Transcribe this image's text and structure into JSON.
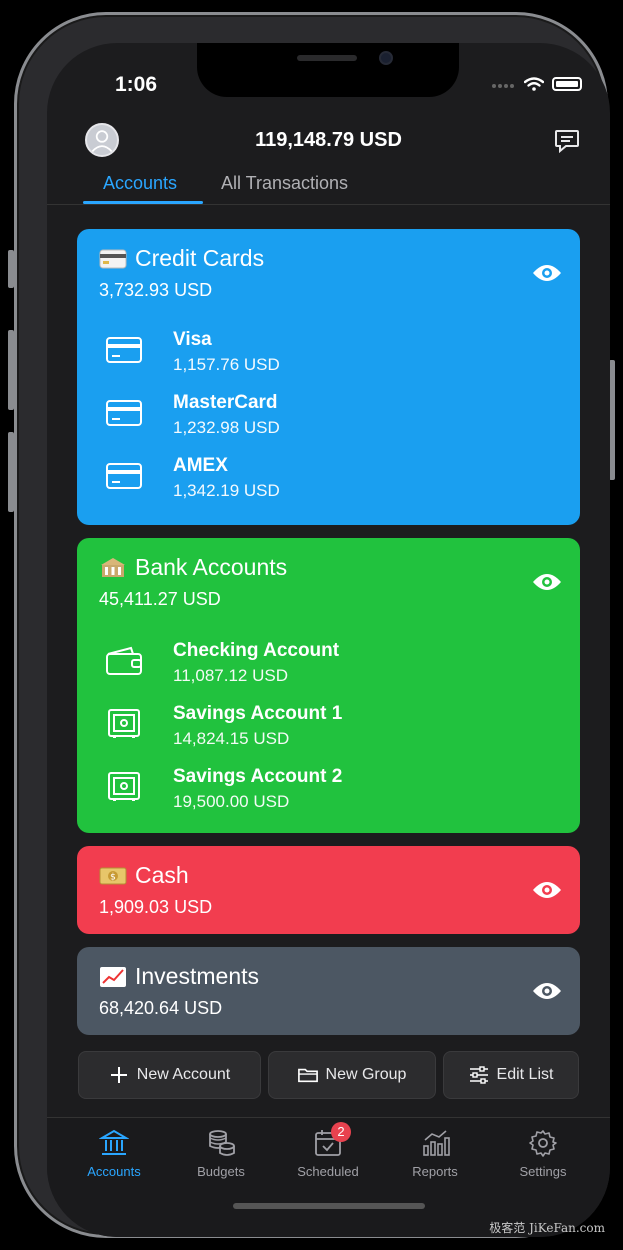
{
  "status": {
    "time": "1:06"
  },
  "header": {
    "total": "119,148.79 USD"
  },
  "tabs": [
    {
      "label": "Accounts",
      "active": true
    },
    {
      "label": "All Transactions",
      "active": false
    }
  ],
  "groups": {
    "credit": {
      "title": "Credit Cards",
      "emoji": "credit-card",
      "total": "3,732.93 USD",
      "color": "#1a9ff0",
      "accounts": [
        {
          "name": "Visa",
          "balance": "1,157.76 USD",
          "icon": "card-icon"
        },
        {
          "name": "MasterCard",
          "balance": "1,232.98 USD",
          "icon": "card-icon"
        },
        {
          "name": "AMEX",
          "balance": "1,342.19 USD",
          "icon": "card-icon"
        }
      ]
    },
    "bank": {
      "title": "Bank Accounts",
      "emoji": "bank",
      "total": "45,411.27 USD",
      "color": "#21c23e",
      "accounts": [
        {
          "name": "Checking Account",
          "balance": "11,087.12 USD",
          "icon": "wallet-icon"
        },
        {
          "name": "Savings Account 1",
          "balance": "14,824.15 USD",
          "icon": "safe-icon"
        },
        {
          "name": "Savings Account 2",
          "balance": "19,500.00 USD",
          "icon": "safe-icon"
        }
      ]
    },
    "cash": {
      "title": "Cash",
      "emoji": "money",
      "total": "1,909.03 USD",
      "color": "#f23d4f"
    },
    "investments": {
      "title": "Investments",
      "emoji": "chart-increasing",
      "total": "68,420.64 USD",
      "color": "#4c5763"
    }
  },
  "actions": {
    "new_account": "New Account",
    "new_group": "New Group",
    "edit_list": "Edit List"
  },
  "tabbar": [
    {
      "label": "Accounts",
      "active": true
    },
    {
      "label": "Budgets"
    },
    {
      "label": "Scheduled",
      "badge": "2"
    },
    {
      "label": "Reports"
    },
    {
      "label": "Settings"
    }
  ],
  "watermark": "极客范 JiKeFan.com",
  "colors": {
    "accent": "#2aa6ff",
    "badge": "#e8424f"
  }
}
